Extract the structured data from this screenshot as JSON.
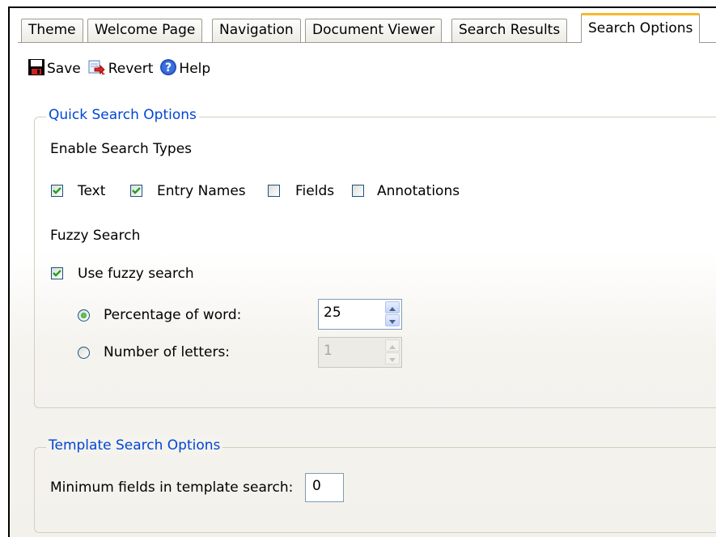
{
  "tabs": [
    {
      "label": "Theme",
      "active": false
    },
    {
      "label": "Welcome Page",
      "active": false
    },
    {
      "label": "Navigation",
      "active": false
    },
    {
      "label": "Document Viewer",
      "active": false
    },
    {
      "label": "Search Results",
      "active": false
    },
    {
      "label": "Search Options",
      "active": true
    }
  ],
  "toolbar": {
    "save_label": "Save",
    "revert_label": "Revert",
    "help_label": "Help"
  },
  "quick": {
    "legend": "Quick Search Options",
    "enable_heading": "Enable Search Types",
    "types": [
      {
        "label": "Text",
        "checked": true
      },
      {
        "label": "Entry Names",
        "checked": true
      },
      {
        "label": "Fields",
        "checked": false
      },
      {
        "label": "Annotations",
        "checked": false
      }
    ],
    "fuzzy_heading": "Fuzzy Search",
    "use_fuzzy": {
      "label": "Use fuzzy search",
      "checked": true
    },
    "percentage": {
      "label": "Percentage of word:",
      "selected": true,
      "value": "25"
    },
    "letters": {
      "label": "Number of letters:",
      "selected": false,
      "value": "1"
    }
  },
  "template": {
    "legend": "Template Search Options",
    "min_fields_label": "Minimum fields in template search:",
    "min_fields_value": "0"
  },
  "colors": {
    "legend_text": "#0046d5",
    "active_tab_accent": "#f6b92b",
    "checkbox_border": "#1c5180",
    "checkmark": "#21a121"
  }
}
